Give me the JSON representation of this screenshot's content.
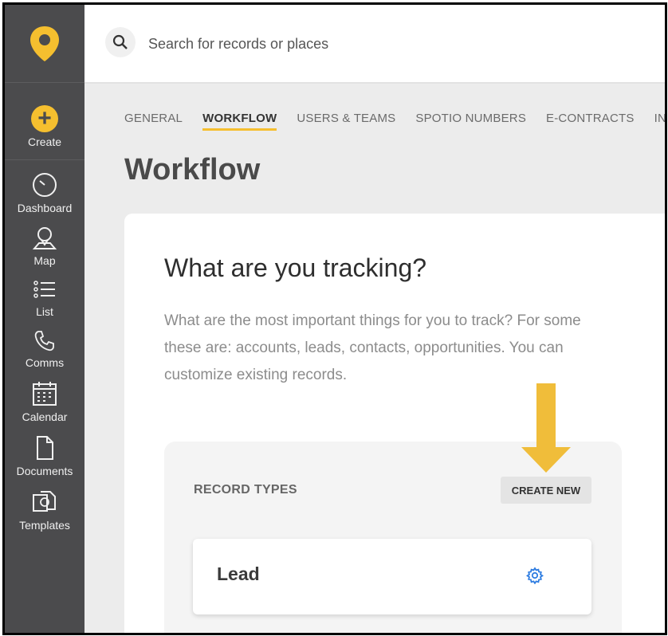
{
  "sidebar": {
    "create_label": "Create",
    "items": [
      {
        "label": "Dashboard",
        "icon": "dashboard-icon"
      },
      {
        "label": "Map",
        "icon": "map-pin-icon"
      },
      {
        "label": "List",
        "icon": "list-icon"
      },
      {
        "label": "Comms",
        "icon": "phone-icon"
      },
      {
        "label": "Calendar",
        "icon": "calendar-icon"
      },
      {
        "label": "Documents",
        "icon": "document-icon"
      },
      {
        "label": "Templates",
        "icon": "templates-icon"
      }
    ]
  },
  "search": {
    "placeholder": "Search for records or places"
  },
  "tabs": [
    {
      "label": "GENERAL"
    },
    {
      "label": "WORKFLOW"
    },
    {
      "label": "USERS & TEAMS"
    },
    {
      "label": "SPOTIO NUMBERS"
    },
    {
      "label": "E-CONTRACTS"
    },
    {
      "label": "IN"
    }
  ],
  "page": {
    "title": "Workflow"
  },
  "card": {
    "heading": "What are you tracking?",
    "description": "What are the most important things for you to track? For some these are: accounts, leads, contacts, opportunities. You can customize existing records.",
    "record_types_label": "RECORD TYPES",
    "create_new_label": "CREATE NEW",
    "records": [
      {
        "name": "Lead"
      }
    ]
  },
  "colors": {
    "accent": "#f5bf2f",
    "sidebar": "#4b4b4d",
    "gear": "#2f7de1",
    "arrow": "#f0bd3a"
  }
}
